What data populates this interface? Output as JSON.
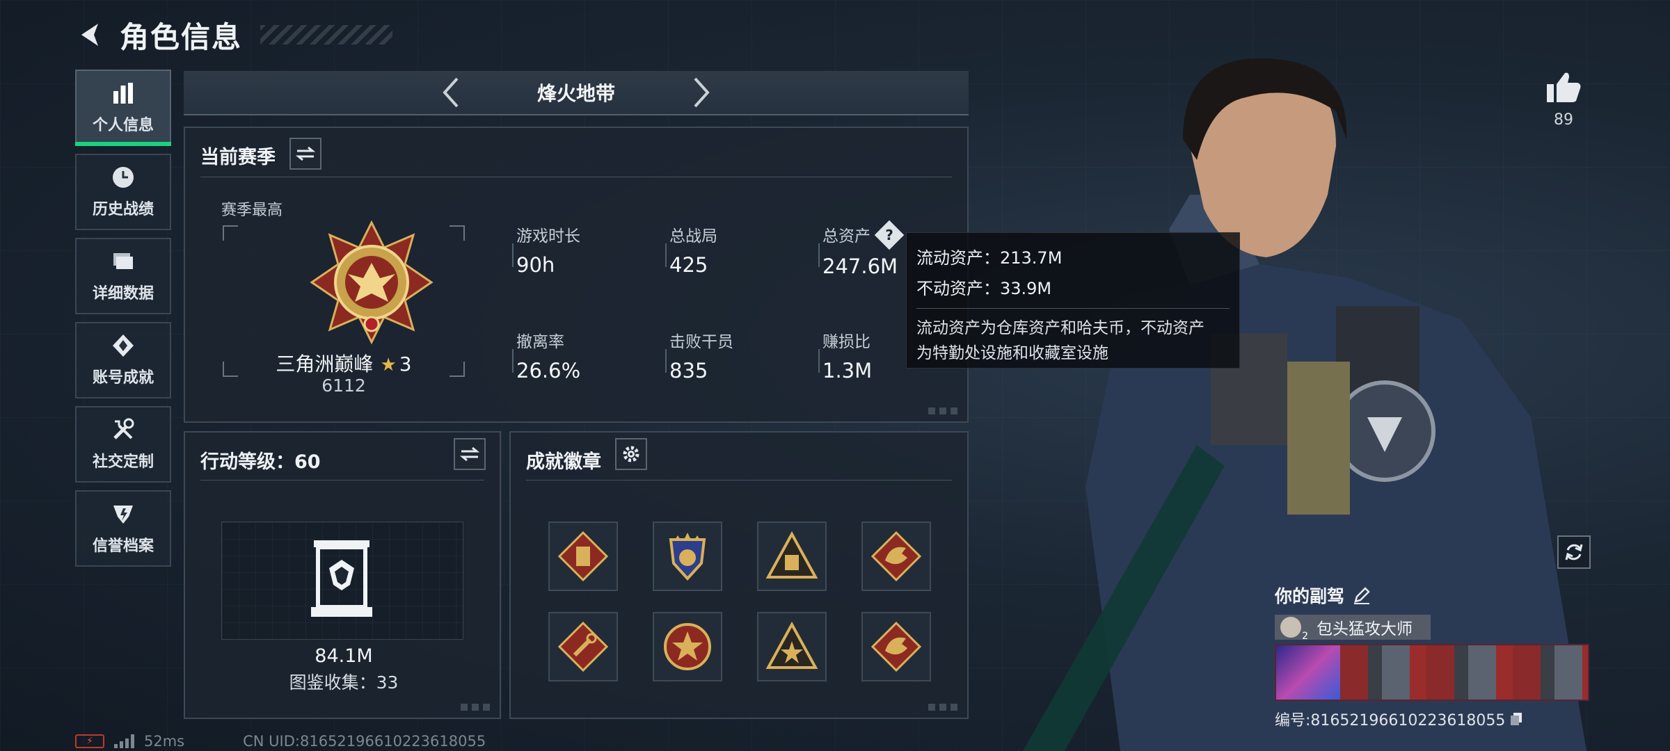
{
  "header": {
    "title": "角色信息"
  },
  "nav": [
    {
      "label": "个人信息",
      "icon": "bar-chart-icon",
      "active": true
    },
    {
      "label": "历史战绩",
      "icon": "history-clock-icon",
      "active": false
    },
    {
      "label": "详细数据",
      "icon": "folder-stack-icon",
      "active": false
    },
    {
      "label": "账号成就",
      "icon": "achievement-diamond-icon",
      "active": false
    },
    {
      "label": "社交定制",
      "icon": "tools-icon",
      "active": false
    },
    {
      "label": "信誉档案",
      "icon": "shield-badge-icon",
      "active": false
    }
  ],
  "mode_selector": {
    "current": "烽火地带"
  },
  "season": {
    "title": "当前赛季",
    "best_label": "赛季最高",
    "rank_name": "三角洲巅峰",
    "rank_stars": "3",
    "rank_score": "6112",
    "stats": [
      {
        "label": "游戏时长",
        "value": "90h"
      },
      {
        "label": "总战局",
        "value": "425"
      },
      {
        "label": "总资产",
        "value": "247.6M"
      },
      {
        "label": "撤离率",
        "value": "26.6%"
      },
      {
        "label": "击败干员",
        "value": "835"
      },
      {
        "label": "赚损比",
        "value": "1.3M"
      }
    ],
    "help_glyph": "?"
  },
  "tooltip": {
    "liquid": "流动资产：213.7M",
    "fixed": "不动资产：33.9M",
    "desc_line1": "流动资产为仓库资产和哈夫币，不动资产",
    "desc_line2": "为特勤处设施和收藏室设施"
  },
  "level": {
    "title": "行动等级：60",
    "collection_value": "84.1M",
    "collection_count": "图鉴收集：33"
  },
  "badges": {
    "title": "成就徽章",
    "items": [
      {
        "icon": "vest-badge-icon"
      },
      {
        "icon": "star-shield-badge-icon"
      },
      {
        "icon": "triangle-crate-badge-icon"
      },
      {
        "icon": "dragon-badge-icon"
      },
      {
        "icon": "wrench-badge-icon"
      },
      {
        "icon": "star-emblem-badge-icon"
      },
      {
        "icon": "triangle-star-badge-icon"
      },
      {
        "icon": "dragon-badge-icon"
      }
    ]
  },
  "likes": {
    "count": "89"
  },
  "copilot": {
    "title": "你的副驾",
    "name": "包头猛攻大师",
    "avatar_level": "2",
    "id_text": "编号:816521966102236180​55"
  },
  "footer": {
    "ping": "52ms",
    "uid": "CN UID:81652196610223618055"
  },
  "colors": {
    "accent_green": "#19d47e",
    "gold": "#e6b64c",
    "badge_red": "#8c2a22"
  }
}
